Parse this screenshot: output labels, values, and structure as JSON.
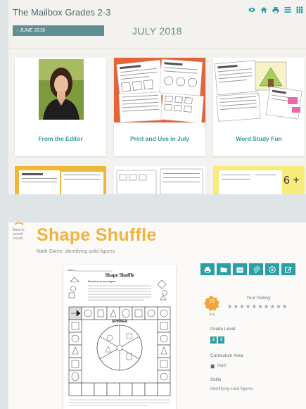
{
  "magazine": {
    "title": "The Mailbox Grades 2-3",
    "prev_month": "‹ JUNE 2018",
    "current_month": "JULY 2018"
  },
  "toolbar_icons": [
    "eye-icon",
    "home-icon",
    "print-icon",
    "list-icon",
    "grid-icon"
  ],
  "cards": [
    {
      "label": "From the Editor"
    },
    {
      "label": "Print and Use in July"
    },
    {
      "label": "Word Study Fun"
    }
  ],
  "row2_text": {
    "right_card": "6 +"
  },
  "game": {
    "back_label": "Back to search results",
    "title": "Shape Shuffle",
    "subtitle": "Math Game: identifying solid figures"
  },
  "worksheet": {
    "title": "Shape Shuffle",
    "name_label": "Name",
    "spinner_label": "SPINNER",
    "directions_label": "Directions for two players:"
  },
  "actions": [
    "print-icon",
    "folder-icon",
    "calendar-icon",
    "attach-icon",
    "download-icon",
    "edit-icon"
  ],
  "rating": {
    "value": "10",
    "avg_label": "Avg",
    "your_rating_label": "Your Rating:",
    "stars": "★★★★★★★★★★"
  },
  "details": {
    "grade_label": "Grade Level",
    "grades": [
      "2",
      "3"
    ],
    "curriculum_label": "Curriculum Area",
    "curriculum_value": "Math",
    "skills_label": "Skills",
    "skills_value": "identifying solid figures"
  },
  "colors": {
    "teal": "#2a9fa6",
    "title_orange": "#f3b23b",
    "badge_orange": "#f2a33a"
  }
}
